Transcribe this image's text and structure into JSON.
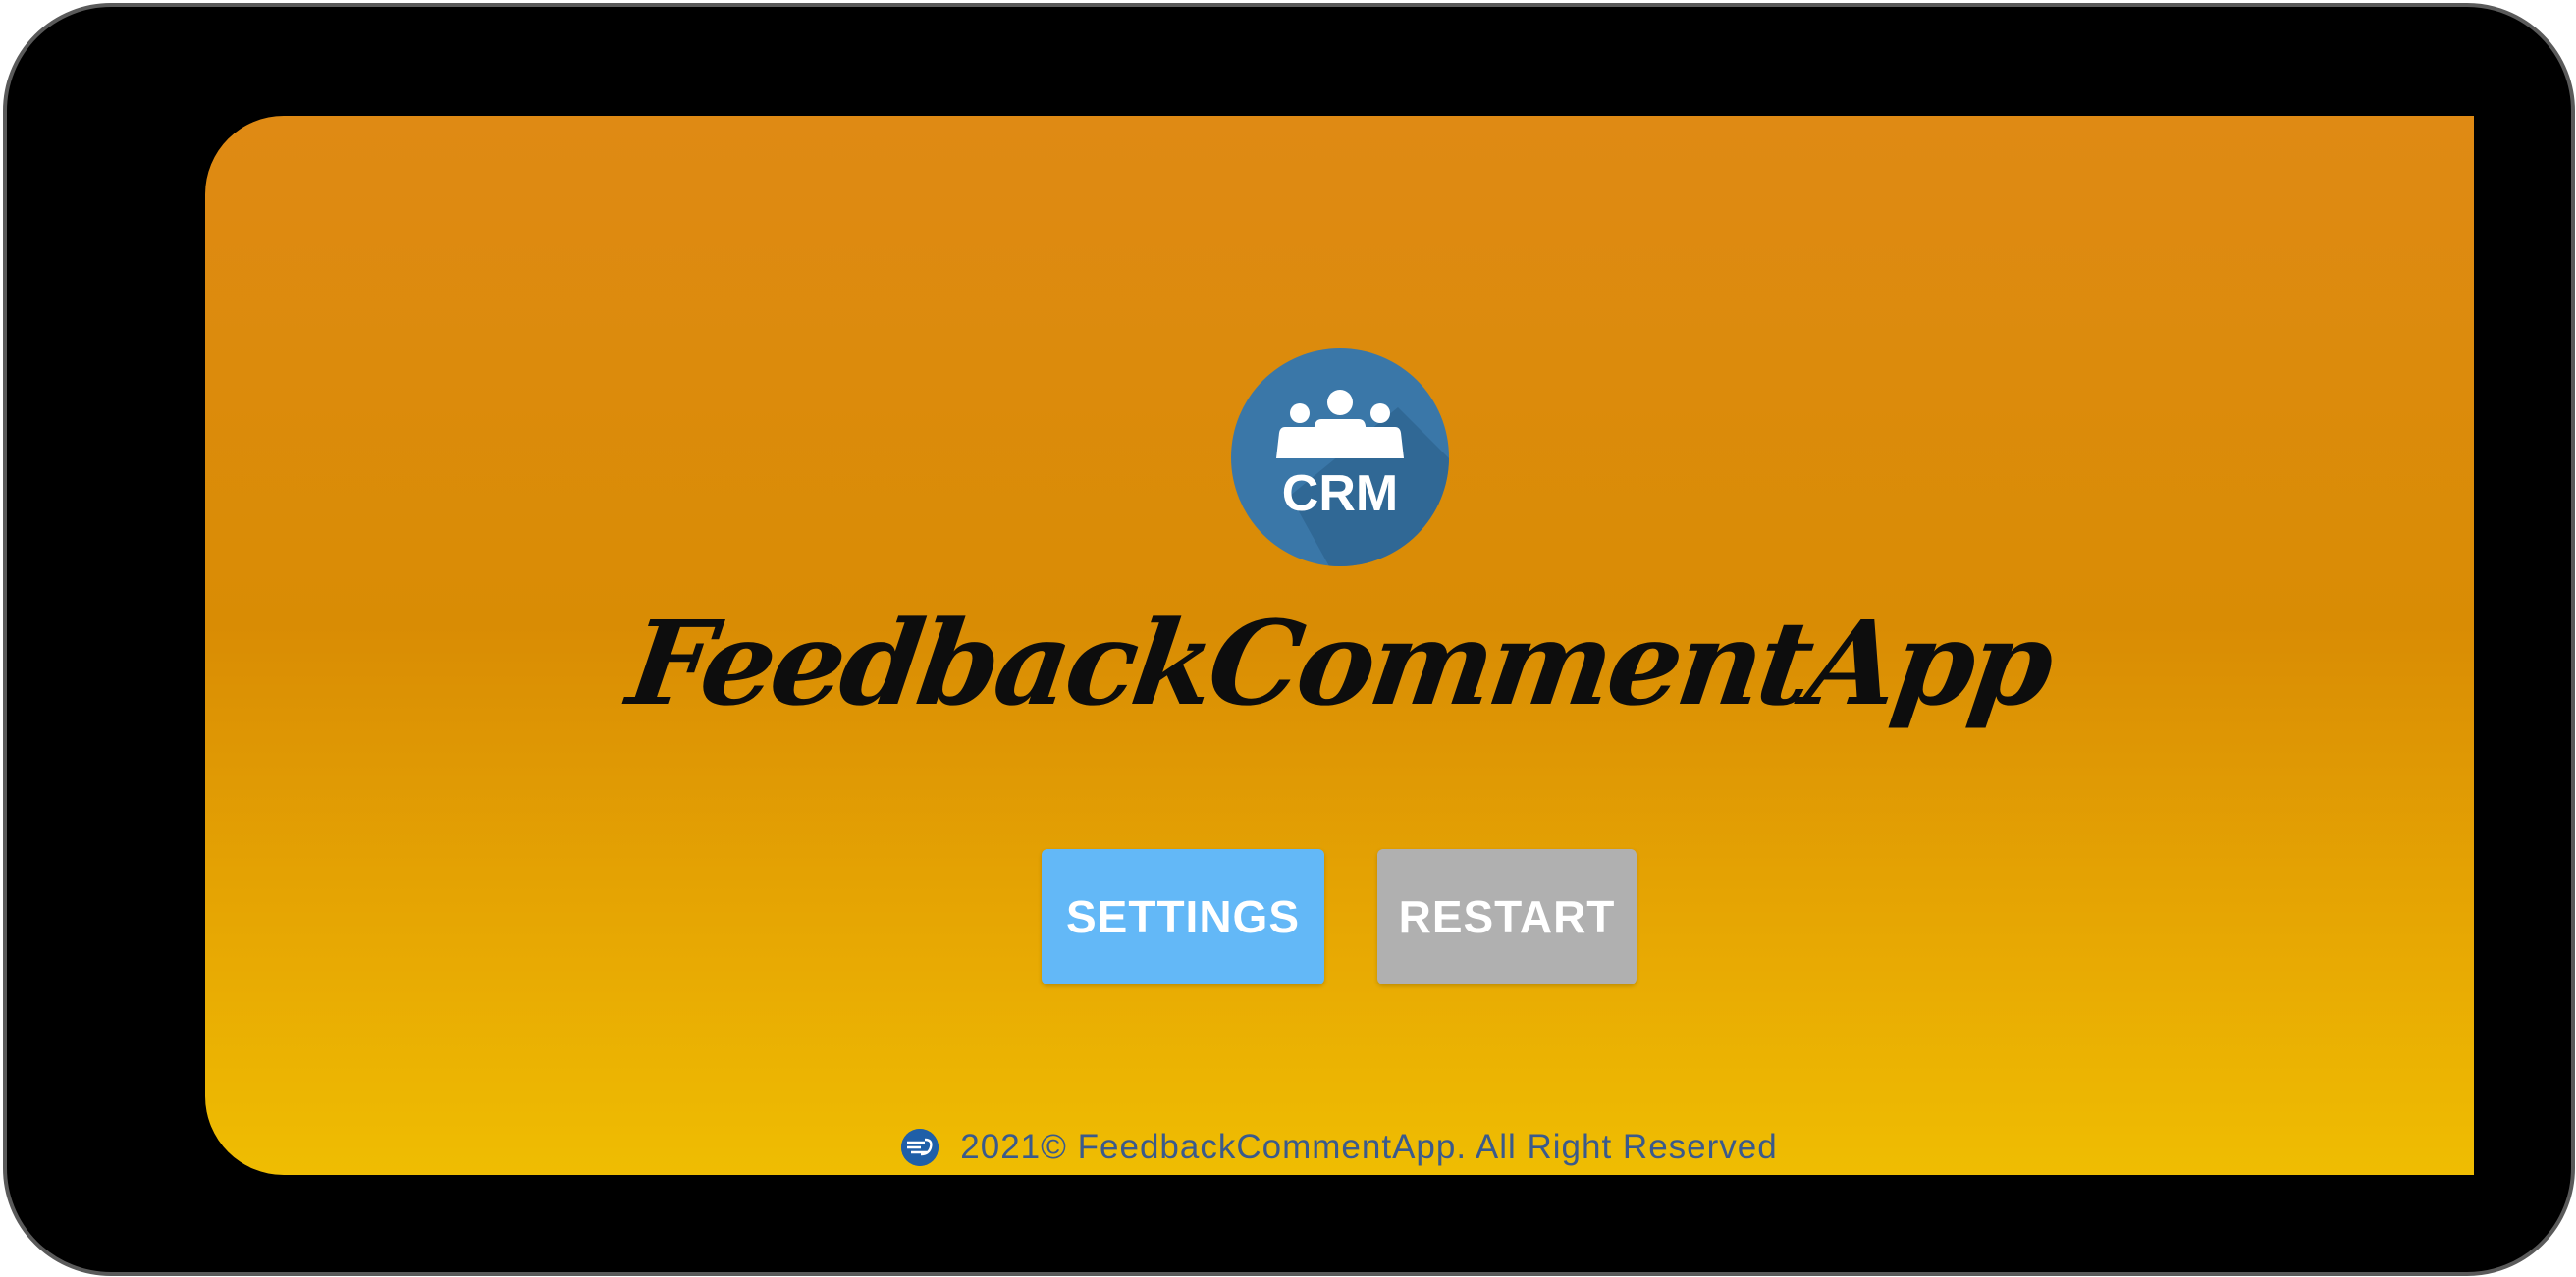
{
  "app": {
    "logo_text": "CRM",
    "title": "FeedbackCommentApp"
  },
  "buttons": {
    "settings_label": "SETTINGS",
    "restart_label": "RESTART"
  },
  "footer": {
    "copyright": "2021© FeedbackCommentApp. All Right Reserved",
    "icon": "company-logo-icon"
  },
  "colors": {
    "background_top": "#df8a14",
    "background_bottom": "#efbd02",
    "settings_button": "#63b8f7",
    "restart_button": "#b0b0b0",
    "logo_circle": "#3a77a8",
    "footer_text": "#3a5a8c"
  }
}
